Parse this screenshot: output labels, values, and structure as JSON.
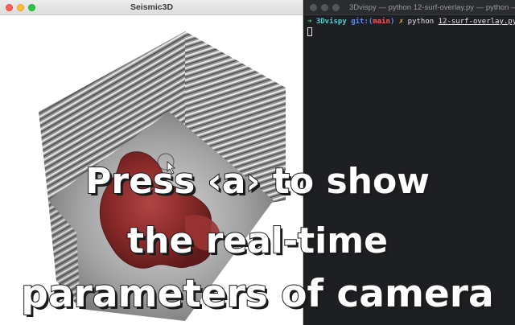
{
  "left_window": {
    "title": "Seismic3D",
    "controls": [
      "close",
      "minimize",
      "maximize"
    ]
  },
  "right_window": {
    "title": "3Dvispy — python 12-surf-overlay.py — python —",
    "prompt": {
      "arrow": "➜",
      "dir": "3Dvispy",
      "git_prefix": "git:(",
      "branch": "main",
      "git_suffix": ")",
      "dirty_mark": "✗",
      "command": "python",
      "file": "12-surf-overlay.py"
    }
  },
  "caption": {
    "line1": "Press ‹a› to show",
    "line2": "the real-time",
    "line3": "parameters of camera"
  },
  "colors": {
    "surface_red": "#8b2a2a",
    "seismic_gray": "#9a9a9a",
    "terminal_bg": "#1e1f23"
  },
  "icons": [
    "mouse-cursor-icon"
  ]
}
